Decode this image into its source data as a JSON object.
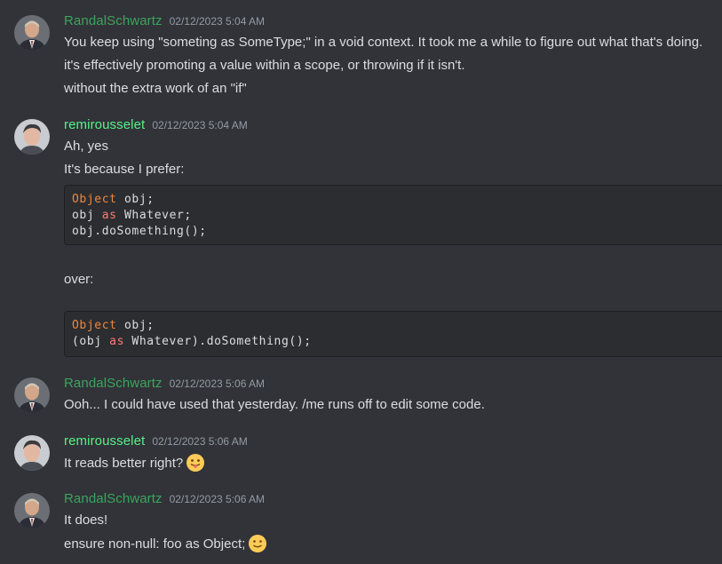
{
  "colors": {
    "background": "#313338",
    "user_randal": "#3ba55c",
    "user_remi": "#57f287",
    "timestamp": "#949ba4",
    "code_bg": "#2b2d31",
    "code_type": "#f0883e",
    "code_keyword": "#ff7b72"
  },
  "messages": [
    {
      "user": "RandalSchwartz",
      "time": "02/12/2023 5:04 AM",
      "lines": [
        "You keep using \"someting as SomeType;\" in a void context.  It took me a while to figure out what that's doing.",
        "it's effectively promoting a value within a scope, or throwing if it isn't.",
        "without the extra work of an \"if\""
      ]
    },
    {
      "user": "remirousselet",
      "time": "02/12/2023 5:04 AM",
      "lines": [
        "Ah, yes",
        "It's because I prefer:"
      ],
      "code1": {
        "l1_type": "Object",
        "l1_rest": " obj;",
        "l2_pre": "obj ",
        "l2_kw": "as",
        "l2_rest": " Whatever;",
        "l3": "obj.doSomething();"
      },
      "middle": "over:",
      "code2": {
        "l1_type": "Object",
        "l1_rest": " obj;",
        "l2_pre": "(obj ",
        "l2_kw": "as",
        "l2_rest": " Whatever).doSomething();"
      }
    },
    {
      "user": "RandalSchwartz",
      "time": "02/12/2023 5:06 AM",
      "lines": [
        "Ooh... I could have used that yesterday.  /me runs off to edit some code."
      ]
    },
    {
      "user": "remirousselet",
      "time": "02/12/2023 5:06 AM",
      "lines": [
        "It reads better right?"
      ],
      "emoji": "tongue-out-emoji"
    },
    {
      "user": "RandalSchwartz",
      "time": "02/12/2023 5:06 AM",
      "lines": [
        "It does!",
        "ensure non-null: foo as Object;"
      ],
      "emoji": "slight-smile-emoji"
    }
  ]
}
